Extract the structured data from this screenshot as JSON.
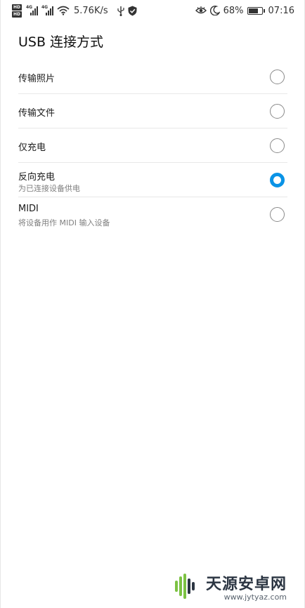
{
  "status_bar": {
    "hd_top": "HD",
    "hd_bottom": "HD",
    "sim1_type": "4G",
    "sim2_type": "4G",
    "net_speed": "5.76K/s",
    "battery_percent": "68%",
    "battery_level": 0.68,
    "time": "07:16",
    "icons": [
      "hd-icon",
      "signal-icon",
      "signal-icon",
      "wifi-icon",
      "usb-icon",
      "shield-icon",
      "eye-comfort-icon",
      "moon-icon",
      "battery-icon"
    ]
  },
  "page": {
    "title": "USB 连接方式"
  },
  "options": [
    {
      "label": "传输照片",
      "sub": "",
      "selected": false
    },
    {
      "label": "传输文件",
      "sub": "",
      "selected": false
    },
    {
      "label": "仅充电",
      "sub": "",
      "selected": false
    },
    {
      "label": "反向充电",
      "sub": "为已连接设备供电",
      "selected": true
    },
    {
      "label": "MIDI",
      "sub": "将设备用作 MIDI 输入设备",
      "selected": false
    }
  ],
  "watermark": {
    "name": "天源安卓网",
    "url": "www.jytyaz.com"
  },
  "colors": {
    "accent": "#0a93e6",
    "text_primary": "#1a1a1a",
    "text_secondary": "#808080",
    "divider": "#e8e8e8"
  }
}
